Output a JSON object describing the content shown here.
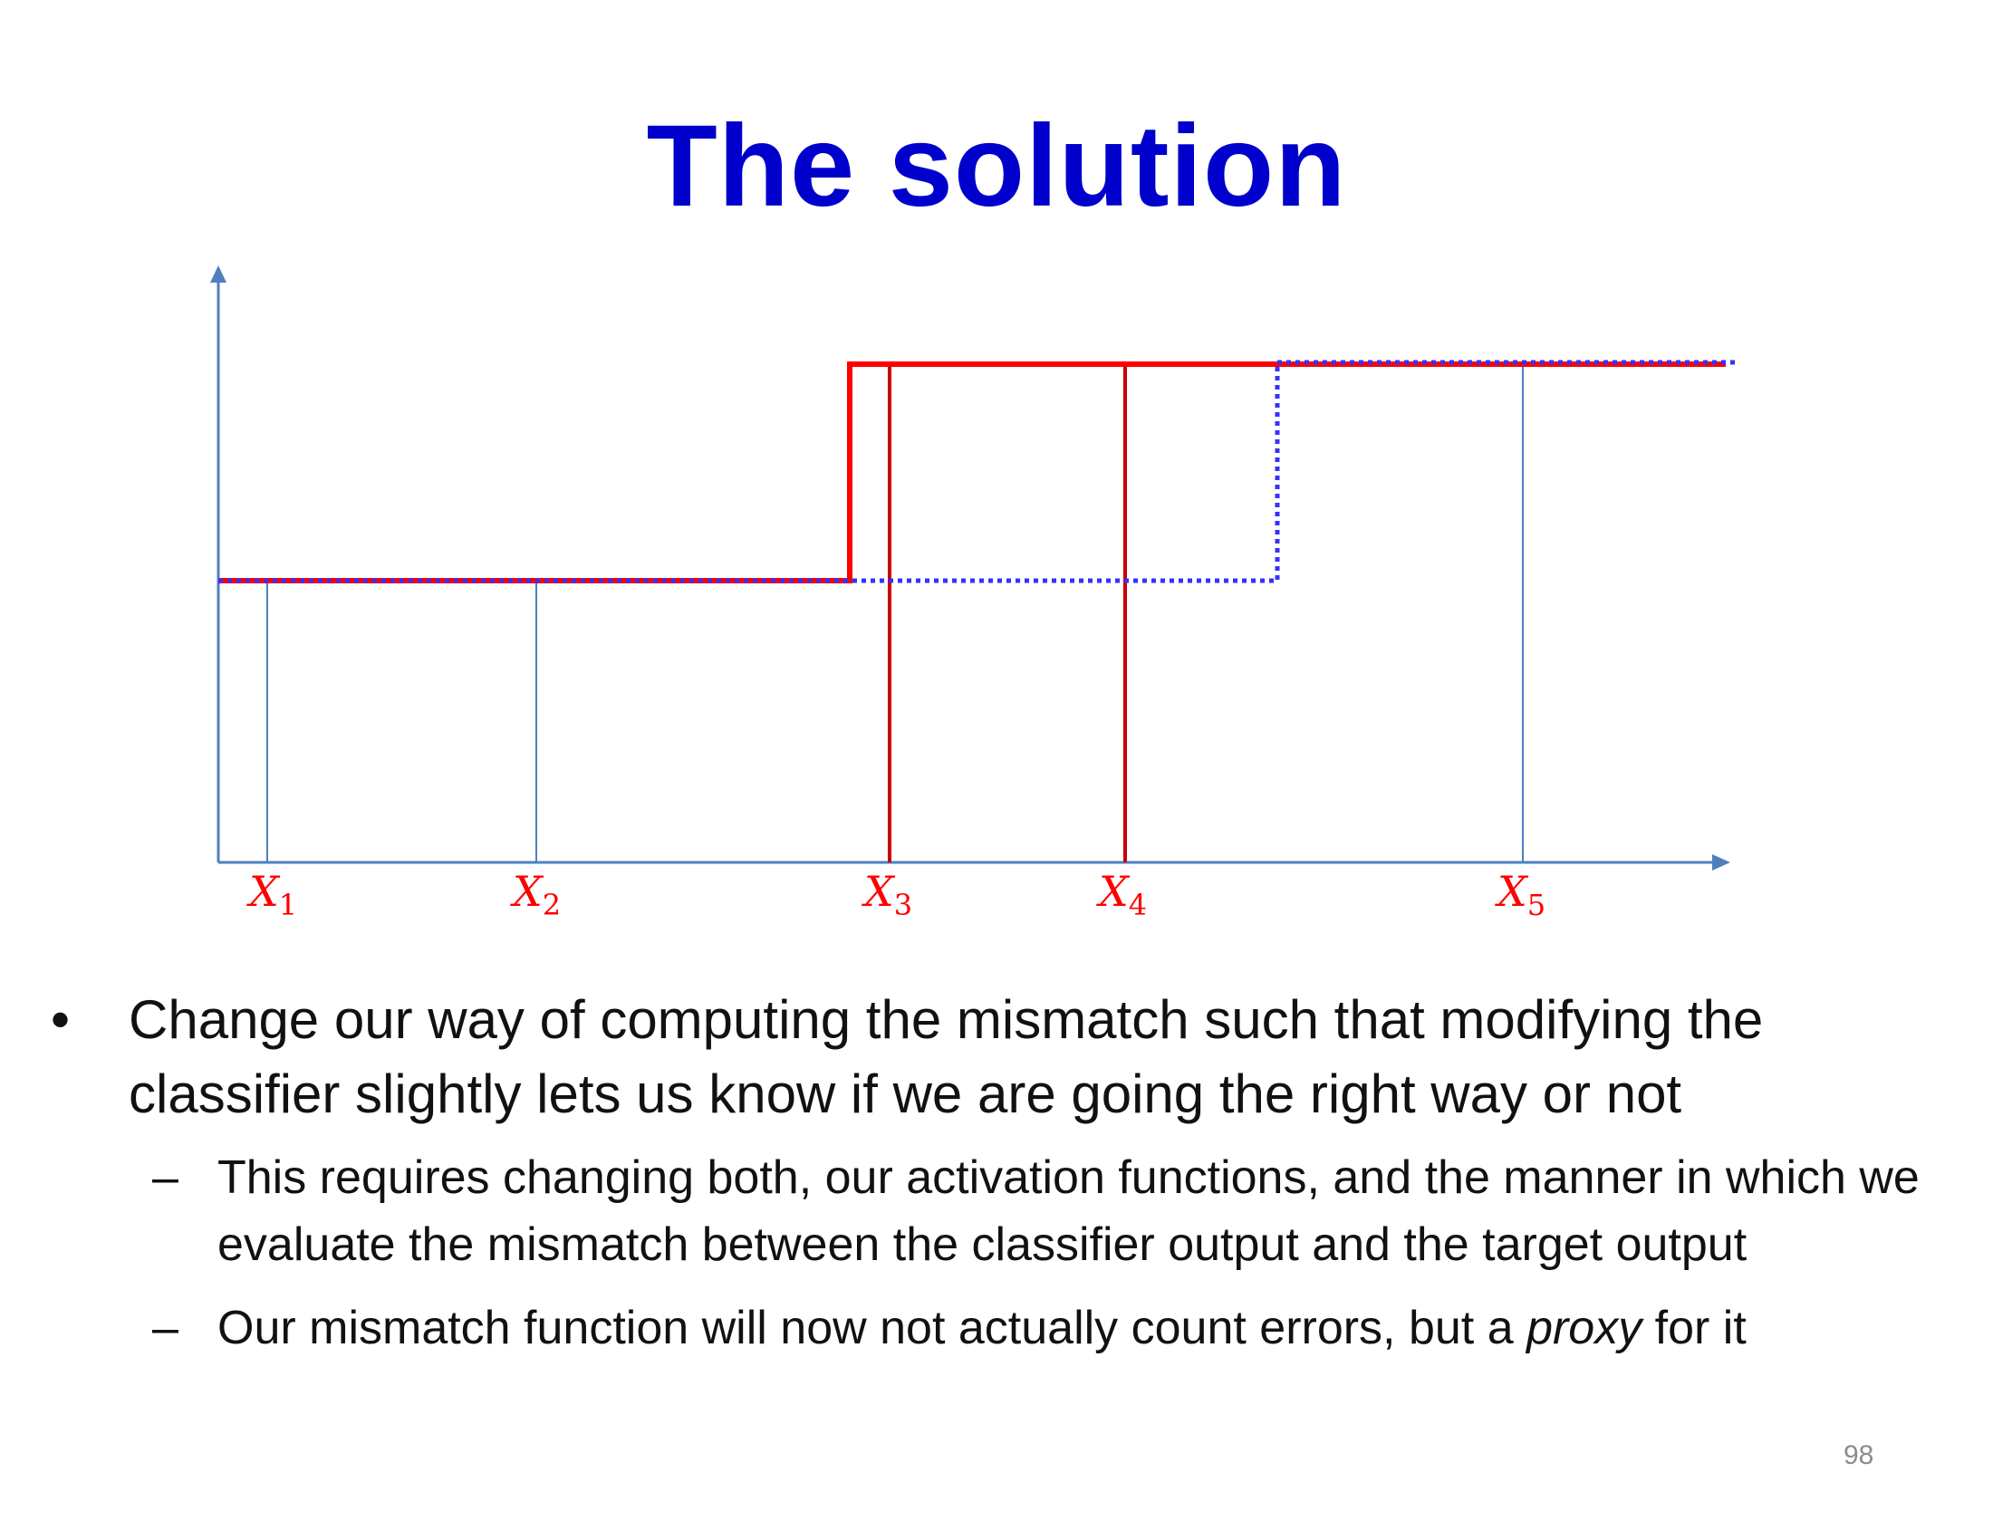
{
  "slide": {
    "title": "The solution",
    "page_number": "98"
  },
  "diagram": {
    "x_labels": [
      {
        "letter": "X",
        "sub": "1"
      },
      {
        "letter": "X",
        "sub": "2"
      },
      {
        "letter": "X",
        "sub": "3"
      },
      {
        "letter": "X",
        "sub": "4"
      },
      {
        "letter": "X",
        "sub": "5"
      }
    ],
    "colors": {
      "axis": "#4f7fbf",
      "instance_blue": "#4f7fbf",
      "instance_red": "#cc0000",
      "step_red": "#ff0000",
      "step_blue_dotted": "#3333ff",
      "label": "#ff0000"
    }
  },
  "bullets": {
    "main": "Change our way of computing the mismatch such that modifying the classifier slightly lets us know if we are going the right way or not",
    "sub1": "This requires changing both, our activation functions, and the manner in which we evaluate the mismatch between the classifier output and the target output",
    "sub2_before": "Our mismatch function will now not actually count errors, but a ",
    "sub2_emphasis": "proxy",
    "sub2_after": " for it"
  }
}
